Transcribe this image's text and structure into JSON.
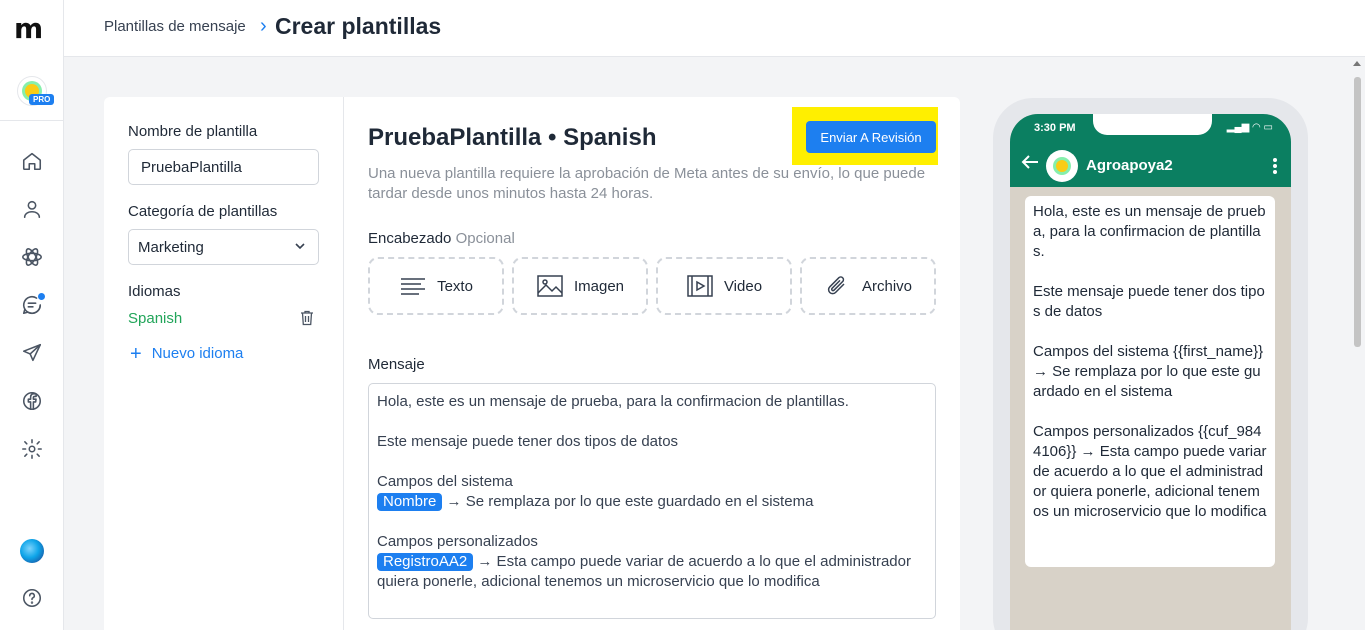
{
  "app": {
    "logo": "m"
  },
  "account": {
    "badge": "PRO"
  },
  "header": {
    "breadcrumb": "Plantillas de mensaje",
    "separator": "›",
    "title": "Crear plantillas"
  },
  "nav": {
    "icons": [
      "home-icon",
      "user-icon",
      "atom-icon",
      "chat-icon",
      "send-icon",
      "facebook-icon",
      "gear-icon",
      "avatar",
      "help-icon"
    ]
  },
  "form": {
    "name_label": "Nombre de plantilla",
    "name_value": "PruebaPlantilla",
    "category_label": "Categoría de plantillas",
    "category_value": "Marketing",
    "languages_label": "Idiomas",
    "language_item": "Spanish",
    "add_language": "Nuevo idioma"
  },
  "editor": {
    "title": "PruebaPlantilla • Spanish",
    "submit_button": "Enviar A Revisión",
    "description": "Una nueva plantilla requiere la aprobación de Meta antes de su envío, lo que puede tardar desde unos minutos hasta 24 horas.",
    "header_label": "Encabezado",
    "header_optional": "Opcional",
    "header_options": [
      "Texto",
      "Imagen",
      "Video",
      "Archivo"
    ],
    "message_label": "Mensaje",
    "message": {
      "line1": "Hola, este es un mensaje de prueba, para la confirmacion de plantillas.",
      "line2": "Este mensaje puede tener dos tipos de datos",
      "line3": "Campos del sistema",
      "tag1": "Nombre",
      "line4": "→ Se remplaza por lo que este guardado en el sistema",
      "line5": "Campos personalizados",
      "tag2": "RegistroAA2",
      "line6": "→ Esta campo puede variar de acuerdo a lo que el administrador quiera ponerle, adicional tenemos un microservicio que lo modifica"
    }
  },
  "preview": {
    "time": "3:30 PM",
    "status_icons": "▂▄▆ ◠ ▭",
    "contact": "Agroapoya2",
    "bubble": {
      "p1": "Hola, este es un mensaje de prueba, para la confirmacion de plantillas.",
      "p2": "Este mensaje puede tener dos tipos de datos",
      "p3": "Campos del sistema {{first_name}} → Se remplaza por lo que este guardado en el sistema",
      "p4": "Campos personalizados {{cuf_9844106}} → Esta campo puede variar de acuerdo a lo que el administrador quiera ponerle, adicional tenemos un microservicio que lo modifica"
    }
  },
  "colors": {
    "accent": "#1d7ff0",
    "whatsapp_green": "#0b7f61",
    "highlight": "#ffef00",
    "language_green": "#22a55a"
  }
}
